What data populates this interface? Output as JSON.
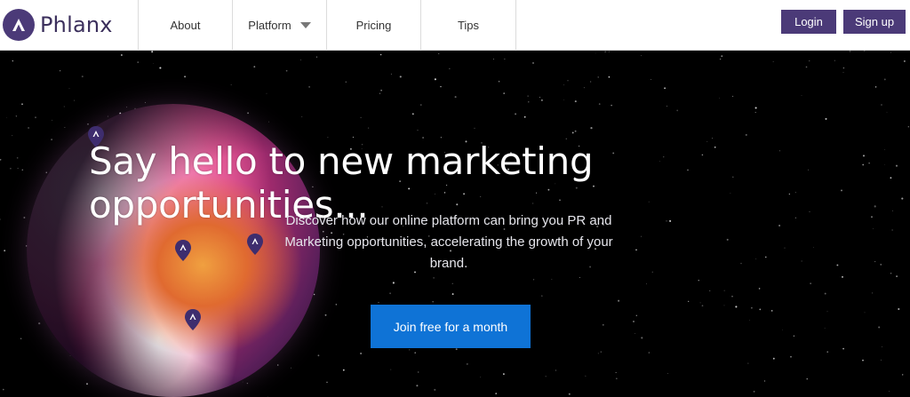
{
  "brand": {
    "name": "Phlanx",
    "color": "#4b3a78"
  },
  "nav": {
    "items": [
      {
        "label": "About"
      },
      {
        "label": "Platform"
      },
      {
        "label": "Pricing"
      },
      {
        "label": "Tips"
      }
    ],
    "login_label": "Login",
    "signup_label": "Sign up"
  },
  "hero": {
    "headline": "Say hello to new marketing opportunities...",
    "subtitle": "Discover how our online platform can bring you PR and Marketing opportunities, accelerating the growth of your brand.",
    "cta_label": "Join free for a month",
    "cta_color": "#0f73d6"
  }
}
